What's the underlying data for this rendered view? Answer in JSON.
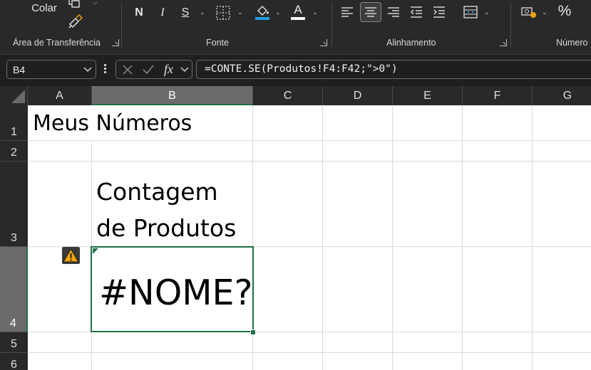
{
  "ribbon": {
    "clipboard": {
      "paste_label": "Colar",
      "group_label": "Área de Transferência"
    },
    "font": {
      "bold": "N",
      "italic": "I",
      "underline": "S",
      "font_color_glyph": "A",
      "group_label": "Fonte"
    },
    "alignment": {
      "group_label": "Alinhamento"
    },
    "number": {
      "percent": "%",
      "group_label": "Número"
    }
  },
  "formula_bar": {
    "name_box": "B4",
    "fx": "fx",
    "formula": "=CONTE.SE(Produtos!F4:F42;\">0\")"
  },
  "columns": [
    "A",
    "B",
    "C",
    "D",
    "E",
    "F",
    "G"
  ],
  "rows": [
    "1",
    "2",
    "3",
    "4",
    "5",
    "6"
  ],
  "selected": {
    "column": "B",
    "row": "4"
  },
  "cells": {
    "A1": "Meus Números",
    "B3_line1": "Contagem",
    "B3_line2": "de Produtos",
    "B4": "#NOME?"
  },
  "colors": {
    "accent": "#1e7145",
    "warning": "#f0a30a",
    "font_color_bar": "#ffffff",
    "fill_color_bar": "#1fa0e0"
  }
}
